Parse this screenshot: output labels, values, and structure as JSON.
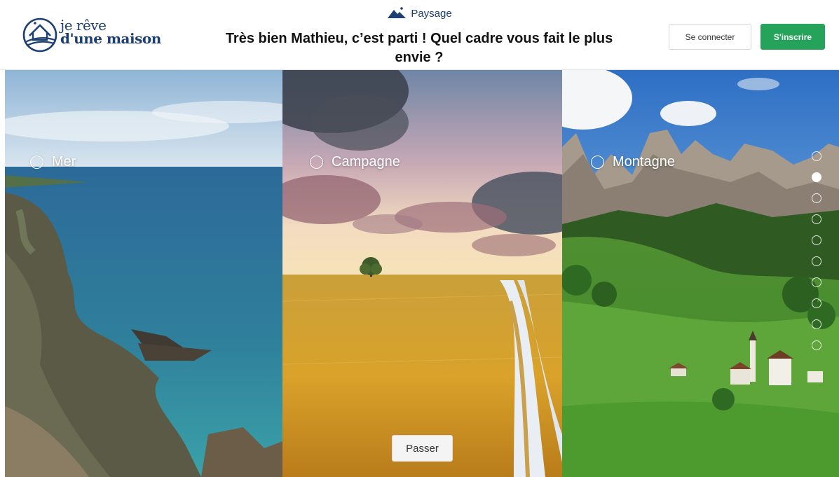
{
  "brand": {
    "line1": "je rêve",
    "line2": "d'une maison",
    "color": "#1d3f73"
  },
  "step": {
    "icon": "mountain-icon",
    "label": "Paysage"
  },
  "question": "Très bien Mathieu, c’est parti ! Quel cadre vous fait le plus envie ?",
  "auth": {
    "login_label": "Se connecter",
    "signup_label": "S'inscrire",
    "signup_color": "#25a35a"
  },
  "options": [
    {
      "label": "Mer",
      "selected": false
    },
    {
      "label": "Campagne",
      "selected": false
    },
    {
      "label": "Montagne",
      "selected": false
    }
  ],
  "progress": {
    "total_steps": 10,
    "current_step": 2
  },
  "skip_label": "Passer"
}
